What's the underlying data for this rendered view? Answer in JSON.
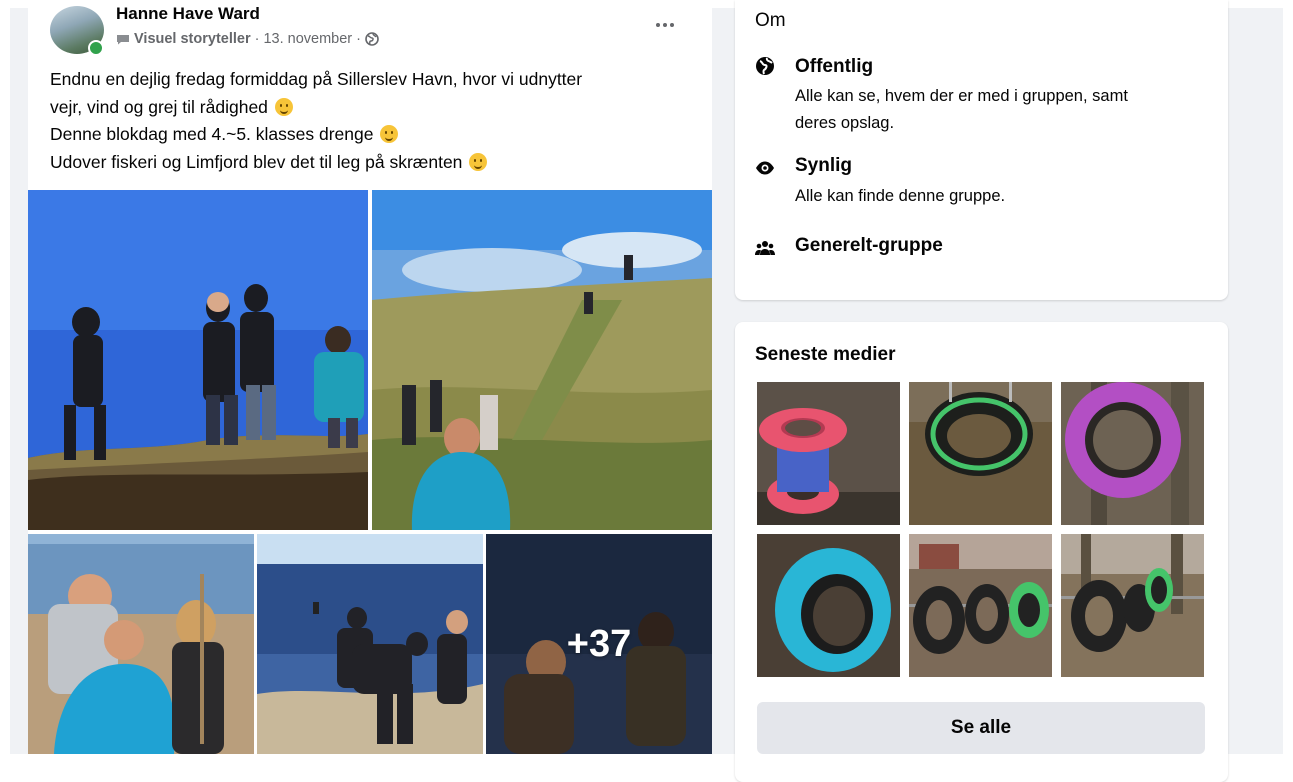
{
  "post": {
    "author": "Hanne Have Ward",
    "role": "Visuel storyteller",
    "date": "13. november",
    "separator": "·",
    "lines": [
      "Endnu en dejlig fredag formiddag på Sillerslev Havn, hvor vi udnytter",
      "vejr, vind og grej til rådighed",
      "Denne blokdag med 4.~5. klasses drenge",
      "Udover fiskeri og Limfjord blev det til leg på skrænten"
    ],
    "more_photos_label": "+37"
  },
  "about": {
    "title": "Om",
    "items": [
      {
        "icon": "globe-icon",
        "title": "Offentlig",
        "desc_lines": [
          "Alle kan se, hvem der er med i gruppen, samt",
          "deres opslag."
        ]
      },
      {
        "icon": "eye-icon",
        "title": "Synlig",
        "desc_lines": [
          "Alle kan finde denne gruppe."
        ]
      },
      {
        "icon": "people-icon",
        "title": "Generelt-gruppe",
        "desc_lines": []
      }
    ]
  },
  "media": {
    "title": "Seneste medier",
    "see_all_label": "Se alle",
    "thumbs": [
      {
        "name": "thumb-red-tires",
        "tire_color": "#e8546f"
      },
      {
        "name": "thumb-green-tire",
        "tire_color": "#45c46a"
      },
      {
        "name": "thumb-purple-tire",
        "tire_color": "#b34fc4"
      },
      {
        "name": "thumb-cyan-tire",
        "tire_color": "#29b6d6"
      },
      {
        "name": "thumb-tire-row",
        "tire_color": "#3b3b3b"
      },
      {
        "name": "thumb-hanging-tires",
        "tire_color": "#3b3b3b"
      }
    ]
  },
  "colors": {
    "page_bg": "#f0f2f5",
    "card_bg": "#ffffff",
    "secondary_text": "#65676b",
    "online": "#31a24c",
    "button_bg": "#e4e6eb"
  }
}
